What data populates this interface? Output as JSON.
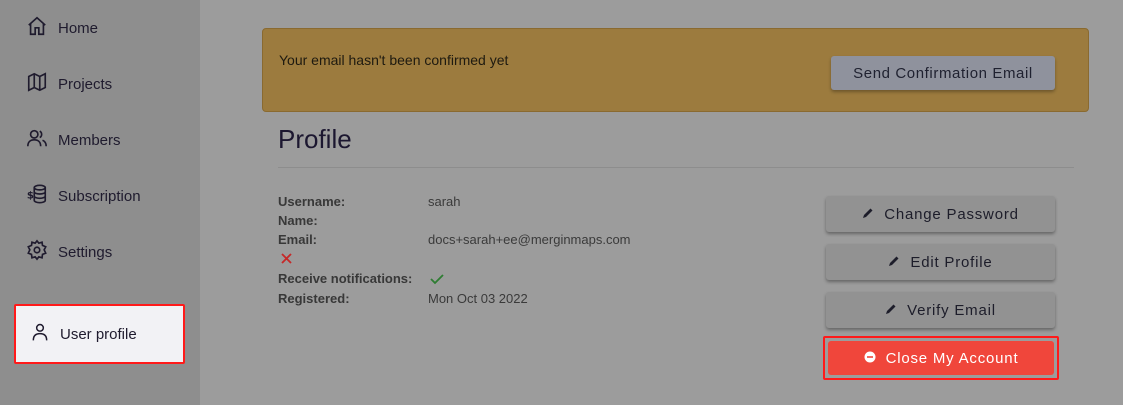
{
  "sidebar": {
    "items": [
      {
        "label": "Home",
        "icon": "home-icon"
      },
      {
        "label": "Projects",
        "icon": "map-icon"
      },
      {
        "label": "Members",
        "icon": "users-icon"
      },
      {
        "label": "Subscription",
        "icon": "coins-icon"
      },
      {
        "label": "Settings",
        "icon": "gear-icon"
      }
    ],
    "active": {
      "label": "User profile",
      "icon": "user-icon"
    }
  },
  "banner": {
    "message": "Your email hasn't been confirmed yet",
    "button_label": "Send Confirmation Email"
  },
  "profile": {
    "title": "Profile",
    "fields": {
      "username_label": "Username:",
      "username_value": "sarah",
      "name_label": "Name:",
      "email_label": "Email:",
      "email_value": "docs+sarah+ee@merginmaps.com",
      "email_status_icon": "x-icon",
      "notifications_label": "Receive notifications:",
      "notifications_icon": "check-icon",
      "registered_label": "Registered:",
      "registered_value": "Mon Oct 03 2022"
    }
  },
  "actions": {
    "change_password": "Change Password",
    "edit_profile": "Edit Profile",
    "verify_email": "Verify Email",
    "close_account": "Close My Account"
  },
  "colors": {
    "highlight_border": "#ff1a1a",
    "danger": "#f0463b",
    "warning_banner": "#9c7b3e",
    "check": "#2e7d32",
    "x_mark": "#c62828"
  }
}
